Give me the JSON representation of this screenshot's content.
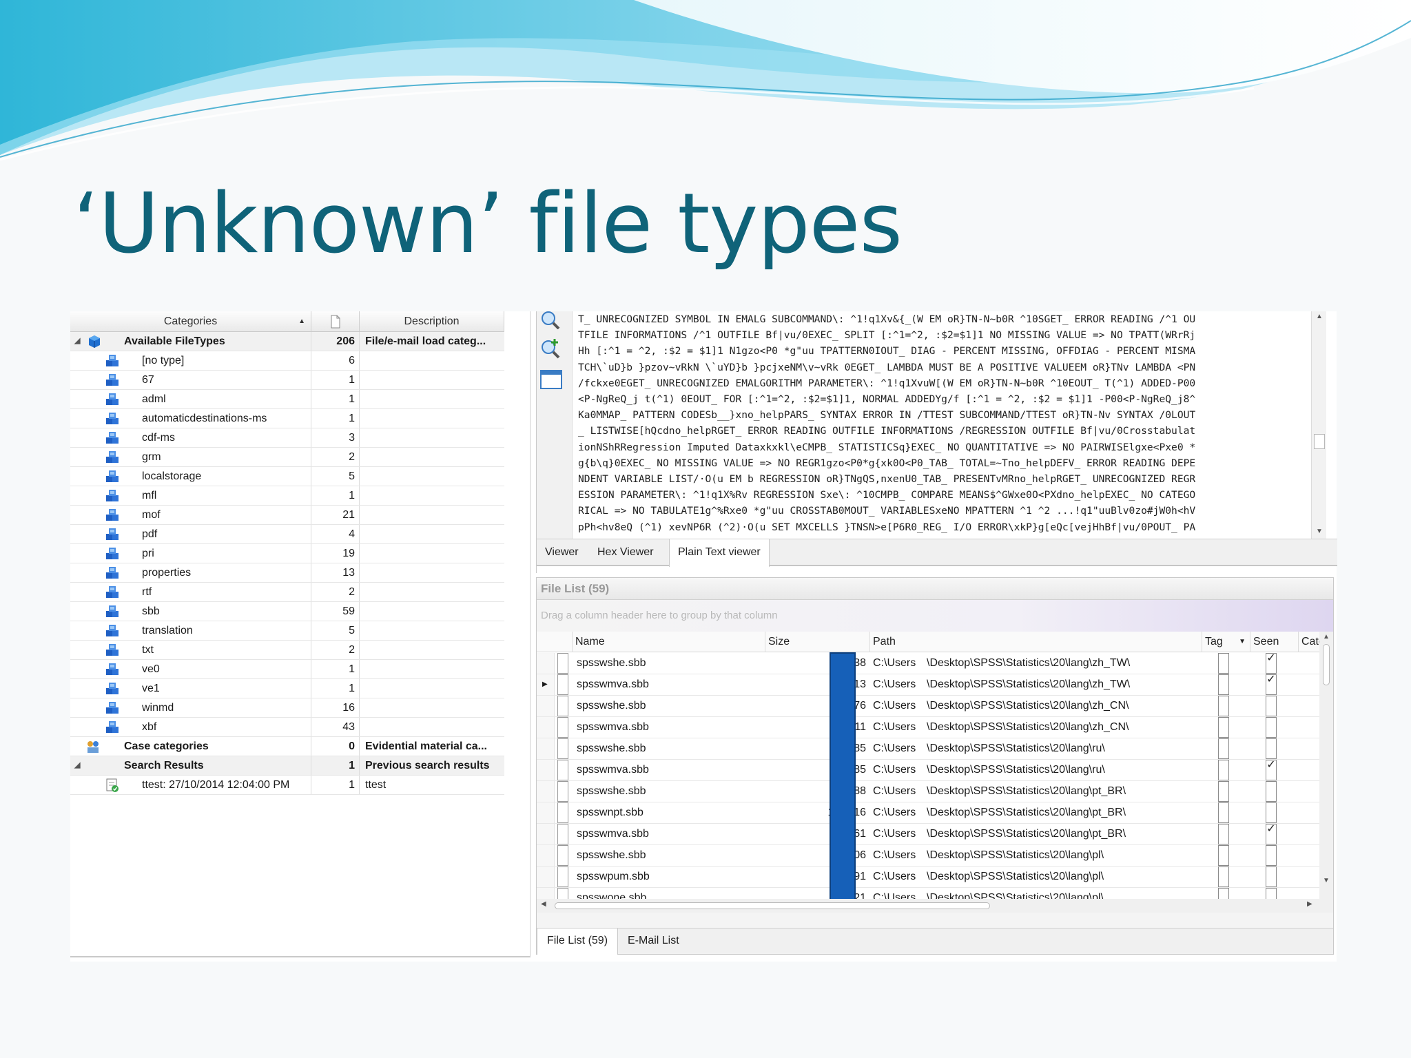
{
  "slide": {
    "title": "‘Unknown’ file types"
  },
  "categories_panel": {
    "headers": {
      "categories": "Categories",
      "description": "Description"
    },
    "root": {
      "label": "Available FileTypes",
      "count": "206",
      "description": "File/e-mail load categ..."
    },
    "filetypes": [
      {
        "label": "[no type]",
        "count": "6"
      },
      {
        "label": "67",
        "count": "1"
      },
      {
        "label": "adml",
        "count": "1"
      },
      {
        "label": "automaticdestinations-ms",
        "count": "1"
      },
      {
        "label": "cdf-ms",
        "count": "3"
      },
      {
        "label": "grm",
        "count": "2"
      },
      {
        "label": "localstorage",
        "count": "5"
      },
      {
        "label": "mfl",
        "count": "1"
      },
      {
        "label": "mof",
        "count": "21"
      },
      {
        "label": "pdf",
        "count": "4"
      },
      {
        "label": "pri",
        "count": "19"
      },
      {
        "label": "properties",
        "count": "13"
      },
      {
        "label": "rtf",
        "count": "2"
      },
      {
        "label": "sbb",
        "count": "59"
      },
      {
        "label": "translation",
        "count": "5"
      },
      {
        "label": "txt",
        "count": "2"
      },
      {
        "label": "ve0",
        "count": "1"
      },
      {
        "label": "ve1",
        "count": "1"
      },
      {
        "label": "winmd",
        "count": "16"
      },
      {
        "label": "xbf",
        "count": "43"
      }
    ],
    "case_categories": {
      "label": "Case categories",
      "count": "0",
      "description": "Evidential material ca..."
    },
    "search_results": {
      "label": "Search Results",
      "count": "1",
      "description": "Previous search results"
    },
    "search_item": {
      "label": "ttest: 27/10/2014 12:04:00 PM",
      "count": "1",
      "description": "ttest"
    }
  },
  "viewer": {
    "lines": [
      "T_ UNRECOGNIZED SYMBOL IN EMALG SUBCOMMAND\\: ^1!q1Xv&{_(W EM oR}TN-N~b0R ^10SGET_ ERROR READING /^1 OU",
      "TFILE INFORMATIONS /^1 OUTFILE Bf|vu/0EXEC_ SPLIT [:^1=^2, :$2=$1]1 NO MISSING VALUE => NO TPATT(WRrRj",
      "Hh [:^1 = ^2, :$2 = $1]1 N1gzo<P0 *g\"uu TPATTERN0IOUT_ DIAG - PERCENT MISSING, OFFDIAG - PERCENT MISMA",
      "TCH\\`uD}b }pzov~vRkN \\`uYD}b }pcjxeNM\\v~vRk 0EGET_ LAMBDA MUST BE A POSITIVE VALUEEM oR}TNv LAMBDA <PN",
      "/fckxe0EGET_ UNRECOGNIZED EMALGORITHM PARAMETER\\: ^1!q1XvuW[(W EM oR}TN-N~b0R ^10EOUT_ T(^1) ADDED-P00",
      "<P-NgReQ_j t(^1) 0EOUT_ FOR [:^1=^2, :$2=$1]1, NORMAL ADDEDYg/f [:^1 = ^2, :$2 = $1]1 -P00<P-NgReQ_j8^",
      "Ka0MMAP_ PATTERN CODESb__}xno_helpPARS_ SYNTAX ERROR IN /TTEST SUBCOMMAND/TTEST oR}TN-Nv SYNTAX /0LOUT",
      "_ LISTWISE[hQcdno_helpRGET_ ERROR READING OUTFILE INFORMATIONS /REGRESSION OUTFILE Bf|vu/0Crosstabulat",
      "ionNShRRegression Imputed Dataxkxkl\\eCMPB_ STATISTICSq}EXEC_ NO QUANTITATIVE => NO PAIRWISElgxe<Pxe0 *",
      "g{b\\q}0EXEC_ NO MISSING VALUE => NO REGR1gzo<P0*g{xk0O<P0_TAB_ TOTAL=~Tno_helpDEFV_ ERROR READING DEPE",
      "NDENT VARIABLE LIST/·O(u EM b REGRESSION oR}TNgQS,nxenU0_TAB_ PRESENTvMRno_helpRGET_ UNRECOGNIZED REGR",
      "ESSION PARAMETER\\: ^1!q1X%Rv REGRESSION Sxe\\: ^10CMPB_ COMPARE MEANS$^GWxe0O<PXdno_helpEXEC_ NO CATEGO",
      "RICAL => NO TABULATE1g^%Rxe0 *g\"uu CROSSTAB0MOUT_ VARIABLESxeNO MPATTERN ^1 ^2 ...!q1\"uuBlv0zo#jW0h<hV",
      "pPh<hv8eQ (^1) xevNP6R (^2)·O(u SET MXCELLS }TNSN>e[P6R0_REG_ I/O ERROR\\xkP}g[eQc[vejHhBf|vu/0POUT_ PA"
    ],
    "tabs": [
      "Viewer",
      "Hex Viewer",
      "Plain Text viewer"
    ],
    "active_tab": "Plain Text viewer"
  },
  "file_list": {
    "title": "File List (59)",
    "group_hint": "Drag a column header here to group by that column",
    "columns": {
      "name": "Name",
      "size": "Size",
      "path": "Path",
      "tag": "Tag",
      "seen": "Seen",
      "category": "Category"
    },
    "rows": [
      {
        "name": "spsswshe.sbb",
        "size": "65,338",
        "path_prefix": "C:\\Users",
        "path_suffix": "\\Desktop\\SPSS\\Statistics\\20\\lang\\zh_TW\\",
        "tag": false,
        "seen": true,
        "current": false
      },
      {
        "name": "spsswmva.sbb",
        "size": "67,513",
        "path_prefix": "C:\\Users",
        "path_suffix": "\\Desktop\\SPSS\\Statistics\\20\\lang\\zh_TW\\",
        "tag": false,
        "seen": true,
        "current": true
      },
      {
        "name": "spsswshe.sbb",
        "size": "65,076",
        "path_prefix": "C:\\Users",
        "path_suffix": "\\Desktop\\SPSS\\Statistics\\20\\lang\\zh_CN\\",
        "tag": false,
        "seen": false,
        "current": false
      },
      {
        "name": "spsswmva.sbb",
        "size": "67,411",
        "path_prefix": "C:\\Users",
        "path_suffix": "\\Desktop\\SPSS\\Statistics\\20\\lang\\zh_CN\\",
        "tag": false,
        "seen": false,
        "current": false
      },
      {
        "name": "spsswshe.sbb",
        "size": "75,685",
        "path_prefix": "C:\\Users",
        "path_suffix": "\\Desktop\\SPSS\\Statistics\\20\\lang\\ru\\",
        "tag": false,
        "seen": false,
        "current": false
      },
      {
        "name": "spsswmva.sbb",
        "size": "84,185",
        "path_prefix": "C:\\Users",
        "path_suffix": "\\Desktop\\SPSS\\Statistics\\20\\lang\\ru\\",
        "tag": false,
        "seen": true,
        "current": false
      },
      {
        "name": "spsswshe.sbb",
        "size": "76,488",
        "path_prefix": "C:\\Users",
        "path_suffix": "\\Desktop\\SPSS\\Statistics\\20\\lang\\pt_BR\\",
        "tag": false,
        "seen": false,
        "current": false
      },
      {
        "name": "spsswnpt.sbb",
        "size": "113,116",
        "path_prefix": "C:\\Users",
        "path_suffix": "\\Desktop\\SPSS\\Statistics\\20\\lang\\pt_BR\\",
        "tag": false,
        "seen": false,
        "current": false
      },
      {
        "name": "spsswmva.sbb",
        "size": "82,561",
        "path_prefix": "C:\\Users",
        "path_suffix": "\\Desktop\\SPSS\\Statistics\\20\\lang\\pt_BR\\",
        "tag": false,
        "seen": true,
        "current": false
      },
      {
        "name": "spsswshe.sbb",
        "size": "75,406",
        "path_prefix": "C:\\Users",
        "path_suffix": "\\Desktop\\SPSS\\Statistics\\20\\lang\\pl\\",
        "tag": false,
        "seen": false,
        "current": false
      },
      {
        "name": "spsswpum.sbb",
        "size": "94,191",
        "path_prefix": "C:\\Users",
        "path_suffix": "\\Desktop\\SPSS\\Statistics\\20\\lang\\pl\\",
        "tag": false,
        "seen": false,
        "current": false
      },
      {
        "name": "spsswone.sbb",
        "size": "99,821",
        "path_prefix": "C:\\Users",
        "path_suffix": "\\Desktop\\SPSS\\Statistics\\20\\lang\\pl\\",
        "tag": false,
        "seen": false,
        "current": false
      }
    ],
    "tabs": [
      "File List (59)",
      "E-Mail List"
    ],
    "active_tab": "File List (59)"
  },
  "colors": {
    "title": "#0f6379",
    "redaction": "#1660b8",
    "filetype_icon": "#1f5fc4"
  },
  "icons": {
    "filetype": "filetype-cube-icon",
    "root": "available-filetypes-icon",
    "case": "case-categories-icon",
    "search": "search-result-icon",
    "zoom": "magnifier-icon",
    "zoom_in": "zoom-in-icon",
    "window": "window-icon"
  }
}
